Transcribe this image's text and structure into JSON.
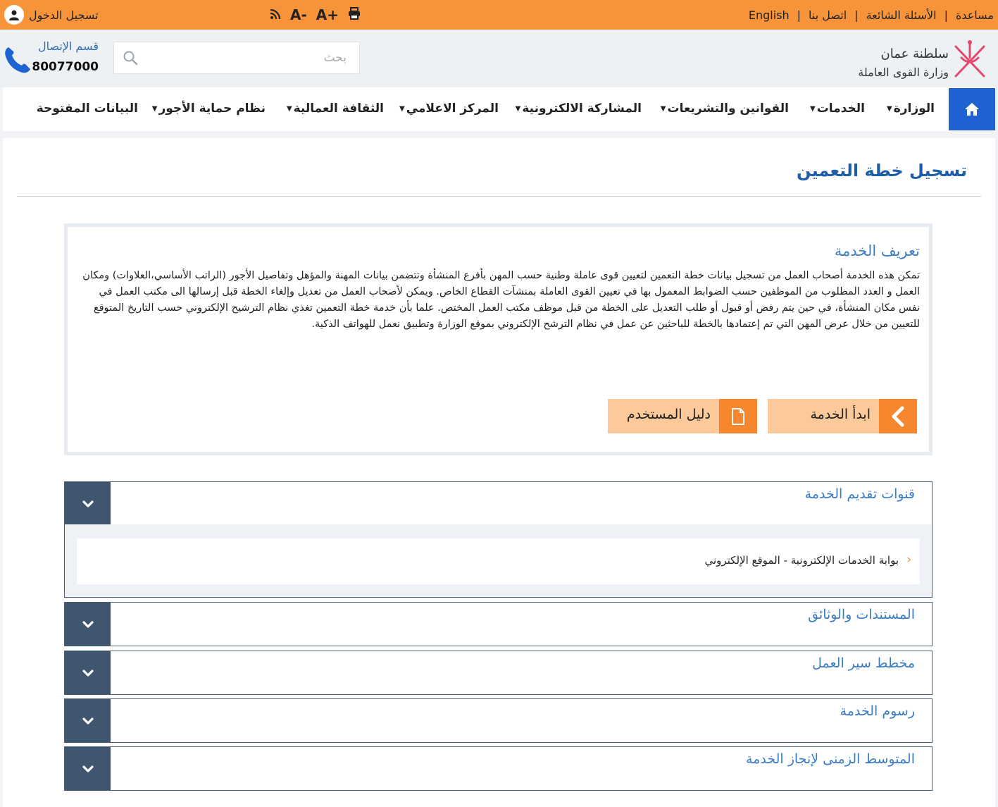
{
  "topbar": {
    "links": [
      "مساعدة",
      "الأسئلة الشائعة",
      "اتصل بنا",
      "English"
    ],
    "separator": "|",
    "tools": {
      "rss": "rss-icon",
      "font_decrease": "A-",
      "font_increase": "A+",
      "print": "print-icon"
    },
    "login_label": "تسجيل الدخول"
  },
  "header": {
    "search_placeholder": "بحث",
    "contact_label": "قسم الإتصال",
    "contact_number": "80077000",
    "logo_line1": "سلطنة عمان",
    "logo_line2": "وزارة القوى العاملة"
  },
  "nav": {
    "items": [
      "الوزارة",
      "الخدمات",
      "القوانين والتشريعات",
      "المشاركة الالكترونية",
      "المركز الاعلامي",
      "الثقافة العمالية",
      "نظام حماية الأجور",
      "البيانات المفتوحة"
    ],
    "caret": "▼"
  },
  "main": {
    "title": "تسجيل خطة التعمين",
    "definition_title": "تعريف الخدمة",
    "definition_text": "تمكن هذه الخدمة أصحاب العمل من تسجيل بيانات خطة التعمين لتعيين قوى عاملة وطنية حسب المهن بأفرع المنشأة وتتضمن بيانات المهنة والمؤهل وتفاصيل الأجور (الراتب الأساسي،العلاوات) ومكان العمل و العدد المطلوب من الموظفين حسب الضوابط المعمول بها في تعيين القوى العاملة بمنشآت القطاع الخاص. ويمكن لأصحاب العمل من تعديل وإلغاء الخطة قبل إرسالها الى مكتب العمل في نفس مكان المنشأة، في حين يتم رفض أو قبول أو طلب التعديل على الخطة من قبل موظف مكتب العمل المختص. علما بأن خدمة خطة التعمين تغذي نظام الترشيح الإلكتروني حسب التاريخ المتوقع للتعيين من خلال عرض المهن التي تم إعتمادها بالخطة للباحثين عن عمل في نظام الترشح الإلكتروني بموقع الوزارة وتطبيق نعمل للهواتف الذكية.",
    "start_button": "ابدأ الخدمة",
    "guide_button": "دليل المستخدم"
  },
  "accordions": [
    {
      "title": "قنوات تقديم الخدمة",
      "expanded": true,
      "items": [
        "بوابة الخدمات الإلكترونية - الموقع الإلكتروني"
      ]
    },
    {
      "title": "المستندات والوثائق",
      "expanded": false
    },
    {
      "title": "مخطط سير العمل",
      "expanded": false
    },
    {
      "title": "رسوم الخدمة",
      "expanded": false
    },
    {
      "title": "المتوسط الزمنى لإنجاز الخدمة",
      "expanded": false
    }
  ],
  "colors": {
    "topbar": "#f7943a",
    "nav_home": "#1f63d3",
    "title_blue": "#1e5ea8",
    "accordion_dark": "#40566e",
    "button_light": "#fbc99a",
    "button_icon": "#f7872e"
  }
}
